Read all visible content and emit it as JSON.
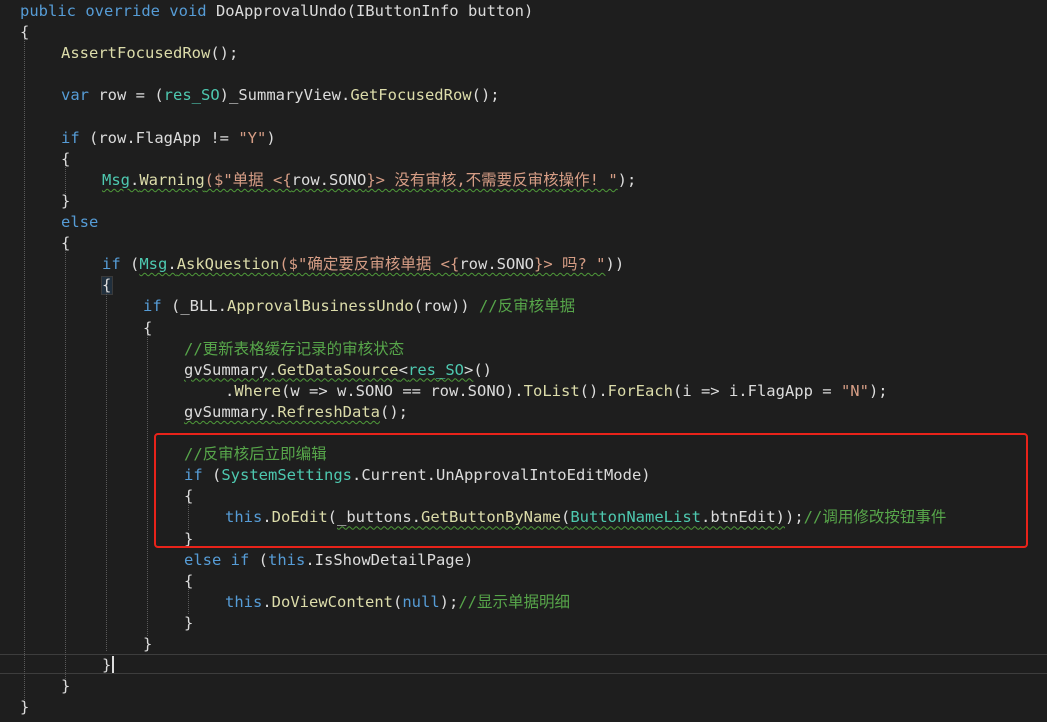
{
  "editor": {
    "colors": {
      "background": "#1e1e1e",
      "keyword": "#569cd6",
      "type": "#4ec9b0",
      "string": "#d69d85",
      "method": "#dcdcaa",
      "comment": "#57a64a",
      "plain": "#dcdcdc",
      "annotation": "#e8231a"
    },
    "lines": [
      {
        "indent": 0,
        "tokens": [
          {
            "t": "public override void ",
            "k": "kw"
          },
          {
            "t": "DoApprovalUndo",
            "k": "pl"
          },
          {
            "t": "(",
            "k": "pl"
          },
          {
            "t": "IButtonInfo",
            "k": "pl"
          },
          {
            "t": " button",
            "k": "pl"
          },
          {
            "t": ")",
            "k": "pl"
          }
        ]
      },
      {
        "indent": 0,
        "tokens": [
          {
            "t": "{",
            "k": "pl"
          }
        ]
      },
      {
        "indent": 1,
        "tokens": [
          {
            "t": "AssertFocusedRow",
            "k": "fn"
          },
          {
            "t": "();",
            "k": "pl"
          }
        ]
      },
      {
        "indent": 0,
        "tokens": []
      },
      {
        "indent": 1,
        "tokens": [
          {
            "t": "var ",
            "k": "kw"
          },
          {
            "t": "row = (",
            "k": "pl"
          },
          {
            "t": "res_SO",
            "k": "ty"
          },
          {
            "t": ")_SummaryView.",
            "k": "pl"
          },
          {
            "t": "GetFocusedRow",
            "k": "fn"
          },
          {
            "t": "();",
            "k": "pl"
          }
        ]
      },
      {
        "indent": 0,
        "tokens": []
      },
      {
        "indent": 1,
        "tokens": [
          {
            "t": "if ",
            "k": "kw"
          },
          {
            "t": "(row.FlagApp != ",
            "k": "pl"
          },
          {
            "t": "\"Y\"",
            "k": "st"
          },
          {
            "t": ")",
            "k": "pl"
          }
        ]
      },
      {
        "indent": 1,
        "tokens": [
          {
            "t": "{",
            "k": "pl"
          }
        ]
      },
      {
        "indent": 2,
        "tokens": [
          {
            "t": "Msg",
            "k": "ty",
            "sq": true
          },
          {
            "t": ".",
            "k": "pl",
            "sq": true
          },
          {
            "t": "Warning",
            "k": "fn",
            "sq": true
          },
          {
            "t": "($\"单据 <{",
            "k": "st",
            "sq": true
          },
          {
            "t": "row.SONO",
            "k": "pl",
            "sq": true
          },
          {
            "t": "}> 没有审核,不需要反审核操作! \"",
            "k": "st",
            "sq": true
          },
          {
            "t": ");",
            "k": "pl"
          }
        ]
      },
      {
        "indent": 1,
        "tokens": [
          {
            "t": "}",
            "k": "pl"
          }
        ]
      },
      {
        "indent": 1,
        "tokens": [
          {
            "t": "else",
            "k": "kw"
          }
        ]
      },
      {
        "indent": 1,
        "tokens": [
          {
            "t": "{",
            "k": "pl"
          }
        ]
      },
      {
        "indent": 2,
        "tokens": [
          {
            "t": "if ",
            "k": "kw"
          },
          {
            "t": "(",
            "k": "pl"
          },
          {
            "t": "Msg",
            "k": "ty",
            "sq": true
          },
          {
            "t": ".",
            "k": "pl",
            "sq": true
          },
          {
            "t": "AskQuestion",
            "k": "fn",
            "sq": true
          },
          {
            "t": "($\"确定要反审核单据 <{",
            "k": "st",
            "sq": true
          },
          {
            "t": "row.SONO",
            "k": "pl",
            "sq": true
          },
          {
            "t": "}> 吗? \"",
            "k": "st",
            "sq": true
          },
          {
            "t": "))",
            "k": "pl"
          }
        ]
      },
      {
        "indent": 2,
        "tokens": [
          {
            "t": "{",
            "k": "pl"
          }
        ]
      },
      {
        "indent": 3,
        "tokens": [
          {
            "t": "if ",
            "k": "kw"
          },
          {
            "t": "(_BLL.",
            "k": "pl"
          },
          {
            "t": "ApprovalBusinessUndo",
            "k": "fn"
          },
          {
            "t": "(row)) ",
            "k": "pl"
          },
          {
            "t": "//反审核单据",
            "k": "cm"
          }
        ]
      },
      {
        "indent": 3,
        "tokens": [
          {
            "t": "{",
            "k": "pl"
          }
        ]
      },
      {
        "indent": 4,
        "tokens": [
          {
            "t": "//更新表格缓存记录的审核状态",
            "k": "cm"
          }
        ]
      },
      {
        "indent": 4,
        "tokens": [
          {
            "t": "gvSummary.",
            "k": "pl",
            "sq": true
          },
          {
            "t": "GetDataSource",
            "k": "fn",
            "sq": true
          },
          {
            "t": "<",
            "k": "pl",
            "sq": true
          },
          {
            "t": "res_SO",
            "k": "ty",
            "sq": true
          },
          {
            "t": ">",
            "k": "pl",
            "sq": true
          },
          {
            "t": "()",
            "k": "pl"
          }
        ]
      },
      {
        "indent": 5,
        "tokens": [
          {
            "t": ".",
            "k": "pl"
          },
          {
            "t": "Where",
            "k": "fn"
          },
          {
            "t": "(w => w.SONO == row.SONO).",
            "k": "pl"
          },
          {
            "t": "ToList",
            "k": "fn"
          },
          {
            "t": "().",
            "k": "pl"
          },
          {
            "t": "ForEach",
            "k": "fn"
          },
          {
            "t": "(i => i.FlagApp = ",
            "k": "pl"
          },
          {
            "t": "\"N\"",
            "k": "st"
          },
          {
            "t": ");",
            "k": "pl"
          }
        ]
      },
      {
        "indent": 4,
        "tokens": [
          {
            "t": "gvSummary.",
            "k": "pl",
            "sq": true
          },
          {
            "t": "RefreshData",
            "k": "fn",
            "sq": true
          },
          {
            "t": "();",
            "k": "pl"
          }
        ]
      },
      {
        "indent": 0,
        "tokens": []
      },
      {
        "indent": 4,
        "tokens": [
          {
            "t": "//反审核后立即编辑",
            "k": "cm"
          }
        ]
      },
      {
        "indent": 4,
        "tokens": [
          {
            "t": "if ",
            "k": "kw"
          },
          {
            "t": "(",
            "k": "pl"
          },
          {
            "t": "SystemSettings",
            "k": "ty"
          },
          {
            "t": ".Current.UnApprovalIntoEditMode)",
            "k": "pl"
          }
        ]
      },
      {
        "indent": 4,
        "tokens": [
          {
            "t": "{",
            "k": "pl"
          }
        ]
      },
      {
        "indent": 5,
        "tokens": [
          {
            "t": "this",
            "k": "kw"
          },
          {
            "t": ".",
            "k": "pl"
          },
          {
            "t": "DoEdit",
            "k": "fn"
          },
          {
            "t": "(",
            "k": "pl"
          },
          {
            "t": "_buttons.",
            "k": "pl",
            "sq": true
          },
          {
            "t": "GetButtonByName",
            "k": "fn",
            "sq": true
          },
          {
            "t": "(",
            "k": "pl",
            "sq": true
          },
          {
            "t": "ButtonNameList",
            "k": "ty",
            "sq": true
          },
          {
            "t": ".btnEdit)",
            "k": "pl",
            "sq": true
          },
          {
            "t": ");",
            "k": "pl"
          },
          {
            "t": "//调用修改按钮事件",
            "k": "cm"
          }
        ]
      },
      {
        "indent": 4,
        "tokens": [
          {
            "t": "}",
            "k": "pl"
          }
        ]
      },
      {
        "indent": 4,
        "tokens": [
          {
            "t": "else if ",
            "k": "kw"
          },
          {
            "t": "(",
            "k": "pl"
          },
          {
            "t": "this",
            "k": "kw"
          },
          {
            "t": ".IsShowDetailPage)",
            "k": "pl"
          }
        ]
      },
      {
        "indent": 4,
        "tokens": [
          {
            "t": "{",
            "k": "pl"
          }
        ]
      },
      {
        "indent": 5,
        "tokens": [
          {
            "t": "this",
            "k": "kw"
          },
          {
            "t": ".",
            "k": "pl"
          },
          {
            "t": "DoViewContent",
            "k": "fn"
          },
          {
            "t": "(",
            "k": "pl"
          },
          {
            "t": "null",
            "k": "kw"
          },
          {
            "t": ");",
            "k": "pl"
          },
          {
            "t": "//显示单据明细",
            "k": "cm"
          }
        ]
      },
      {
        "indent": 4,
        "tokens": [
          {
            "t": "}",
            "k": "pl"
          }
        ]
      },
      {
        "indent": 3,
        "tokens": [
          {
            "t": "}",
            "k": "pl"
          }
        ]
      },
      {
        "indent": 2,
        "tokens": [
          {
            "t": "}",
            "k": "pl"
          }
        ]
      },
      {
        "indent": 1,
        "tokens": [
          {
            "t": "}",
            "k": "pl"
          }
        ]
      },
      {
        "indent": 0,
        "tokens": [
          {
            "t": "}",
            "k": "pl"
          }
        ]
      }
    ]
  }
}
